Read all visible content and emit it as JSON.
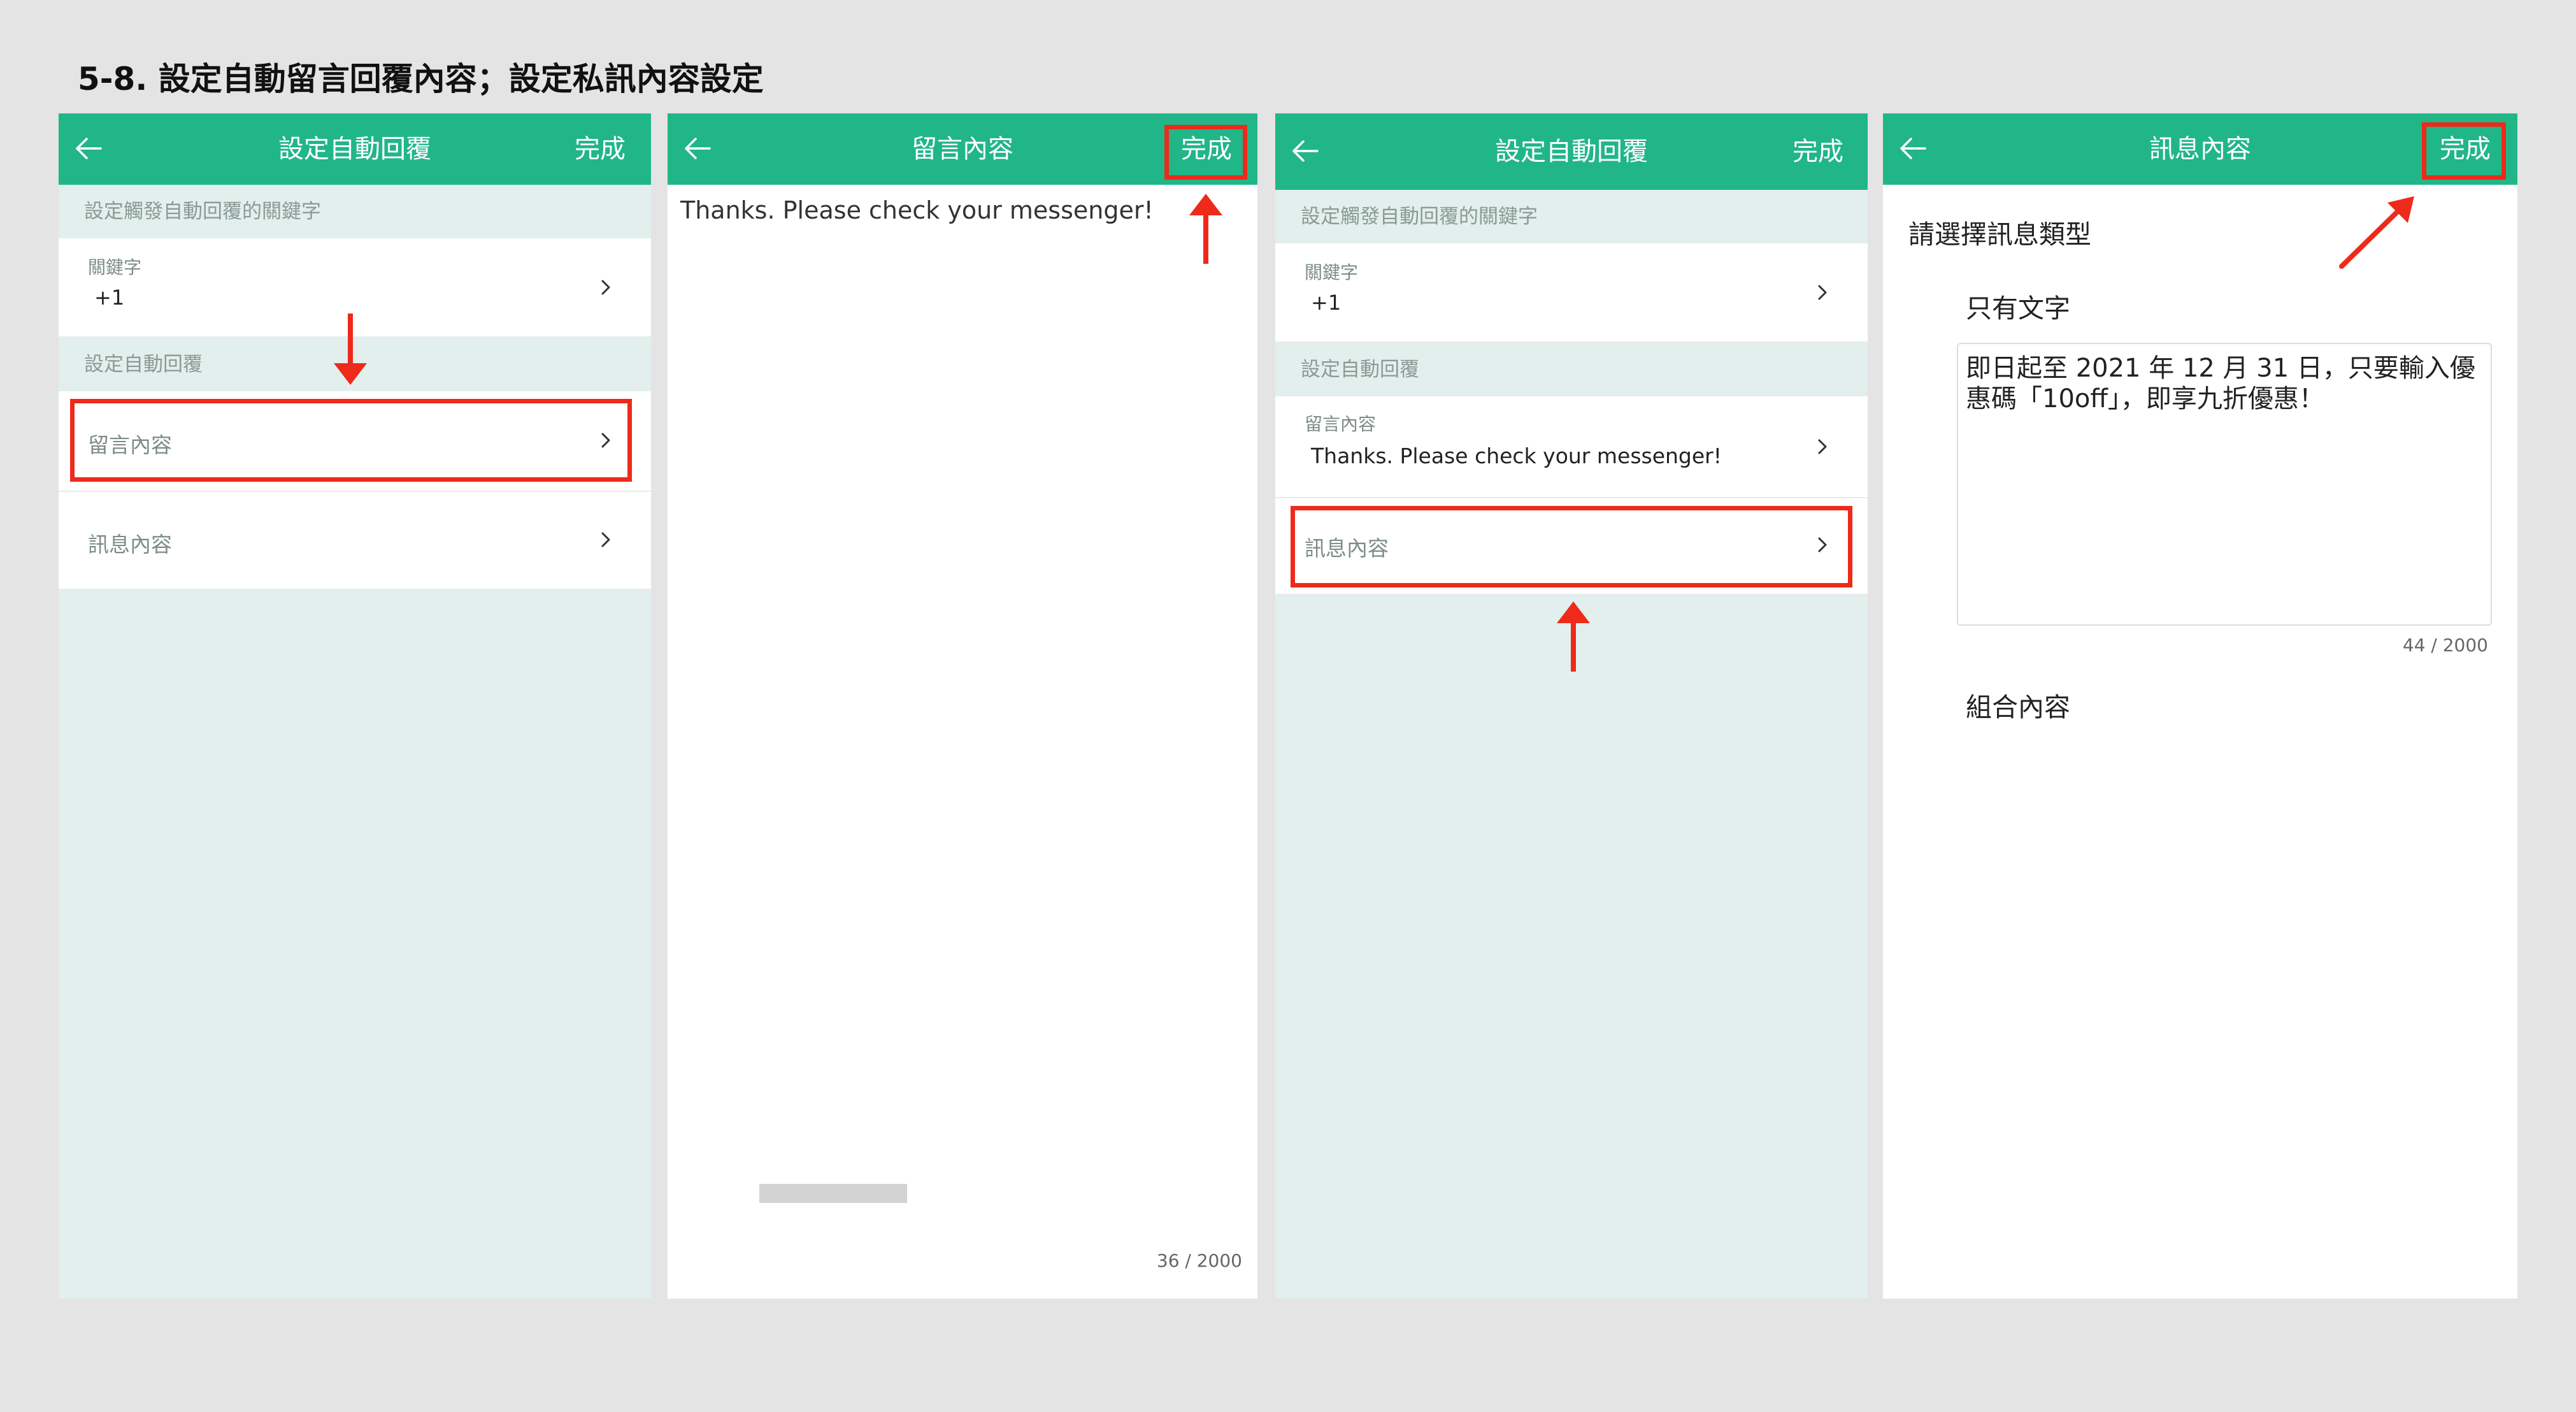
{
  "page": {
    "title": "5-8. 設定自動留言回覆內容；設定私訊內容設定"
  },
  "panel1": {
    "header_title": "設定自動回覆",
    "done_label": "完成",
    "section_keyword": "設定觸發自動回覆的關鍵字",
    "keyword_label": "關鍵字",
    "keyword_value": "+1",
    "section_reply": "設定自動回覆",
    "comment_item": "留言內容",
    "message_item": "訊息內容"
  },
  "panel2": {
    "header_title": "留言內容",
    "done_label": "完成",
    "text": "Thanks. Please check your messenger!",
    "counter": "36 / 2000"
  },
  "panel3": {
    "header_title": "設定自動回覆",
    "done_label": "完成",
    "section_keyword": "設定觸發自動回覆的關鍵字",
    "keyword_label": "關鍵字",
    "keyword_value": "+1",
    "section_reply": "設定自動回覆",
    "comment_label": "留言內容",
    "comment_value": "Thanks. Please check your messenger!",
    "message_item": "訊息內容"
  },
  "panel4": {
    "header_title": "訊息內容",
    "done_label": "完成",
    "prompt": "請選擇訊息類型",
    "option_text_only": "只有文字",
    "message_text": "即日起至 2021 年 12 月 31 日，只要輸入優\n惠碼「10off」，即享九折優惠！",
    "counter": "44 / 2000",
    "option_combined": "組合內容"
  },
  "colors": {
    "brand_green": "#21b688",
    "highlight_red": "#ee2a1a",
    "section_bg": "#e2efec"
  },
  "icons": {
    "back": "arrow-left",
    "chevron": "chevron-right",
    "pointer": "red-arrow"
  }
}
